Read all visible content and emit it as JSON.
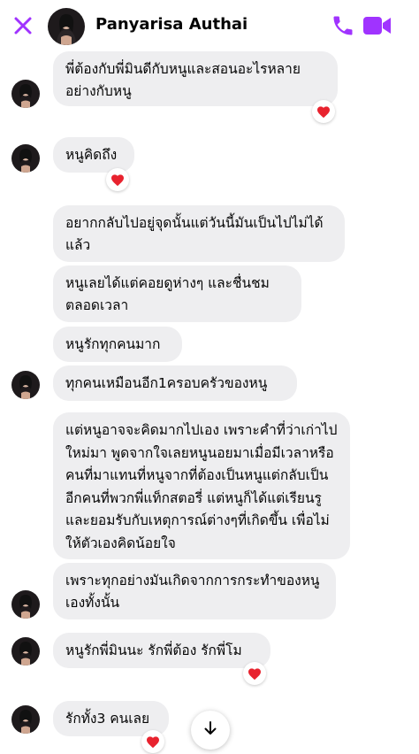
{
  "header": {
    "contact_name": "Panyarisa Authai",
    "accent_color": "#a033ff"
  },
  "messages": [
    {
      "id": "m1",
      "text": "พี่ต้องกับพี่มินดีกับหนูและสอนอะไรหลายอย่างกับหนู",
      "reaction": "red-heart"
    },
    {
      "id": "m2",
      "text": "หนูคิดถึง",
      "reaction": "red-heart"
    },
    {
      "id": "m3",
      "text": "อยากกลับไปอยู่จุดนั้นแต่วันนี้มันเป็นไปไม่ได้แล้ว"
    },
    {
      "id": "m4",
      "text": "หนูเลยได้แต่คอยดูห่างๆ และชื่นชมตลอดเวลา"
    },
    {
      "id": "m5",
      "text": "หนูรักทุกคนมาก"
    },
    {
      "id": "m6",
      "text": "ทุกคนเหมือนอีก1ครอบครัวของหนู"
    },
    {
      "id": "m7",
      "text": "แต่หนูอาจจะคิดมากไปเอง เพราะคำที่ว่าเก่าไปใหม่มา พูดจากใจเลยหนูนอยมาเมื่อมีเวลาหรือคนที่มาแทนที่หนูจากที่ต้องเป็นหนูแต่กลับเป็นอีกคนที่พวกพี่แท็กสตอรี่ แต่หนูก็ได้แต่เรียนรูและยอมรับกับเหตุการณ์ต่างๆที่เกิดขึ้น เพื่อไม่ให้ตัวเองคิดน้อยใจ"
    },
    {
      "id": "m8",
      "text": "เพราะทุกอย่างมันเกิดจากการกระทำของหนูเองทั้งนั้น"
    },
    {
      "id": "m9",
      "text": "หนูรักพี่มินนะ รักพี่ต้อง รักพี่โม",
      "reaction": "red-heart"
    },
    {
      "id": "m10",
      "text": "รักทั้ง3 คนเลย",
      "reaction": "red-heart"
    }
  ],
  "icons": {
    "close": "close-icon",
    "call": "phone-icon",
    "video": "video-camera-icon",
    "scroll": "arrow-down-icon"
  },
  "colors": {
    "bubble": "#eeeef0",
    "heart": "#e8222e"
  }
}
